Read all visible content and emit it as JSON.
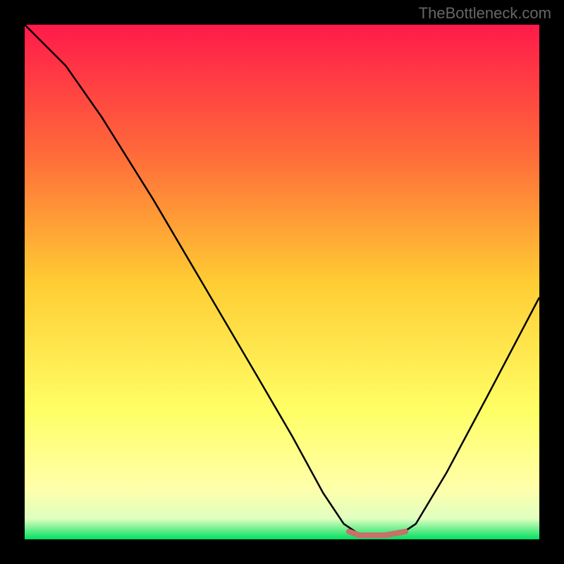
{
  "watermark": "TheBottleneck.com",
  "chart_data": {
    "type": "line",
    "title": "",
    "xlabel": "",
    "ylabel": "",
    "xlim": [
      0,
      100
    ],
    "ylim": [
      0,
      100
    ],
    "background_gradient": {
      "stops": [
        {
          "offset": 0,
          "color": "#ff1a4a"
        },
        {
          "offset": 25,
          "color": "#ff6a3a"
        },
        {
          "offset": 50,
          "color": "#ffcc33"
        },
        {
          "offset": 75,
          "color": "#ffff66"
        },
        {
          "offset": 90,
          "color": "#ffffaa"
        },
        {
          "offset": 96,
          "color": "#e0ffc0"
        },
        {
          "offset": 100,
          "color": "#00e060"
        }
      ]
    },
    "series": [
      {
        "name": "bottleneck-curve",
        "color": "#000000",
        "points": [
          {
            "x": 0,
            "y": 100
          },
          {
            "x": 8,
            "y": 92
          },
          {
            "x": 15,
            "y": 82
          },
          {
            "x": 25,
            "y": 66
          },
          {
            "x": 35,
            "y": 49
          },
          {
            "x": 45,
            "y": 32
          },
          {
            "x": 52,
            "y": 20
          },
          {
            "x": 58,
            "y": 9
          },
          {
            "x": 62,
            "y": 3
          },
          {
            "x": 65,
            "y": 1
          },
          {
            "x": 70,
            "y": 1
          },
          {
            "x": 73,
            "y": 1
          },
          {
            "x": 76,
            "y": 3
          },
          {
            "x": 82,
            "y": 13
          },
          {
            "x": 90,
            "y": 28
          },
          {
            "x": 100,
            "y": 47
          }
        ]
      }
    ],
    "marker": {
      "name": "optimal-range",
      "color": "#c8706a",
      "points": [
        {
          "x": 63,
          "y": 1.5
        },
        {
          "x": 65,
          "y": 0.8
        },
        {
          "x": 70,
          "y": 0.8
        },
        {
          "x": 74,
          "y": 1.5
        }
      ]
    }
  }
}
